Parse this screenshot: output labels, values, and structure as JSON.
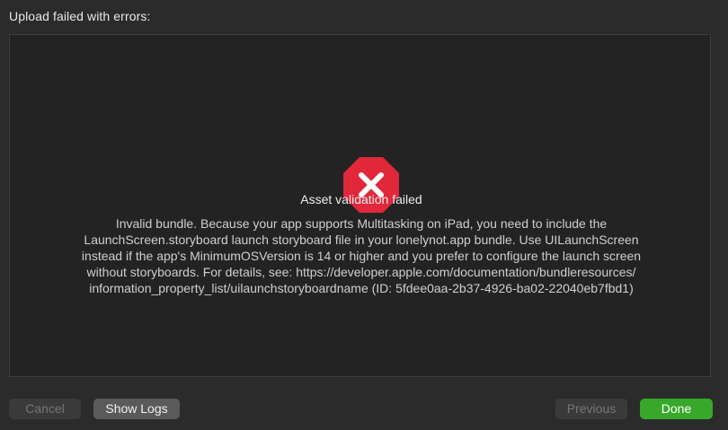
{
  "header": {
    "title": "Upload failed with errors:"
  },
  "message": {
    "icon": "error-octagon-icon",
    "title": "Asset validation failed",
    "body_lines": [
      "Invalid bundle. Because your app supports Multitasking on iPad, you need to include the",
      "LaunchScreen.storyboard launch storyboard file in your lonelynot.app bundle. Use UILaunchScreen",
      "instead if the app's MinimumOSVersion is 14 or higher and you prefer to configure the launch screen",
      "without storyboards. For details, see: https://developer.apple.com/documentation/bundleresources/",
      "information_property_list/uilaunchstoryboardname (ID: 5fdee0aa-2b37-4926-ba02-22040eb7fbd1)"
    ]
  },
  "buttons": {
    "cancel": "Cancel",
    "show_logs": "Show Logs",
    "previous": "Previous",
    "done": "Done"
  },
  "colors": {
    "error_red": "#e0283a",
    "done_green": "#38a82b",
    "background": "#2b2b2b",
    "panel": "#232323"
  }
}
